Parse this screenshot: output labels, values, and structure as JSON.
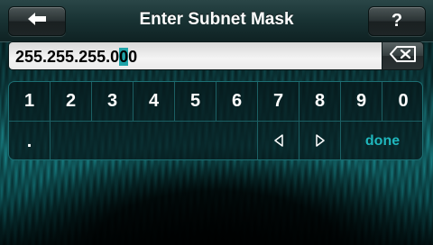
{
  "header": {
    "title": "Enter Subnet Mask",
    "help_label": "?"
  },
  "field": {
    "value_before_cursor": "255.255.255.0",
    "value_at_cursor": "0",
    "value_after_cursor": "0"
  },
  "keypad": {
    "digits": [
      "1",
      "2",
      "3",
      "4",
      "5",
      "6",
      "7",
      "8",
      "9",
      "0"
    ],
    "dot_label": ".",
    "done_label": "done"
  },
  "colors": {
    "accent": "#1fa3a8",
    "done_text": "#1fb7bd",
    "background": "#0f4a4e"
  }
}
